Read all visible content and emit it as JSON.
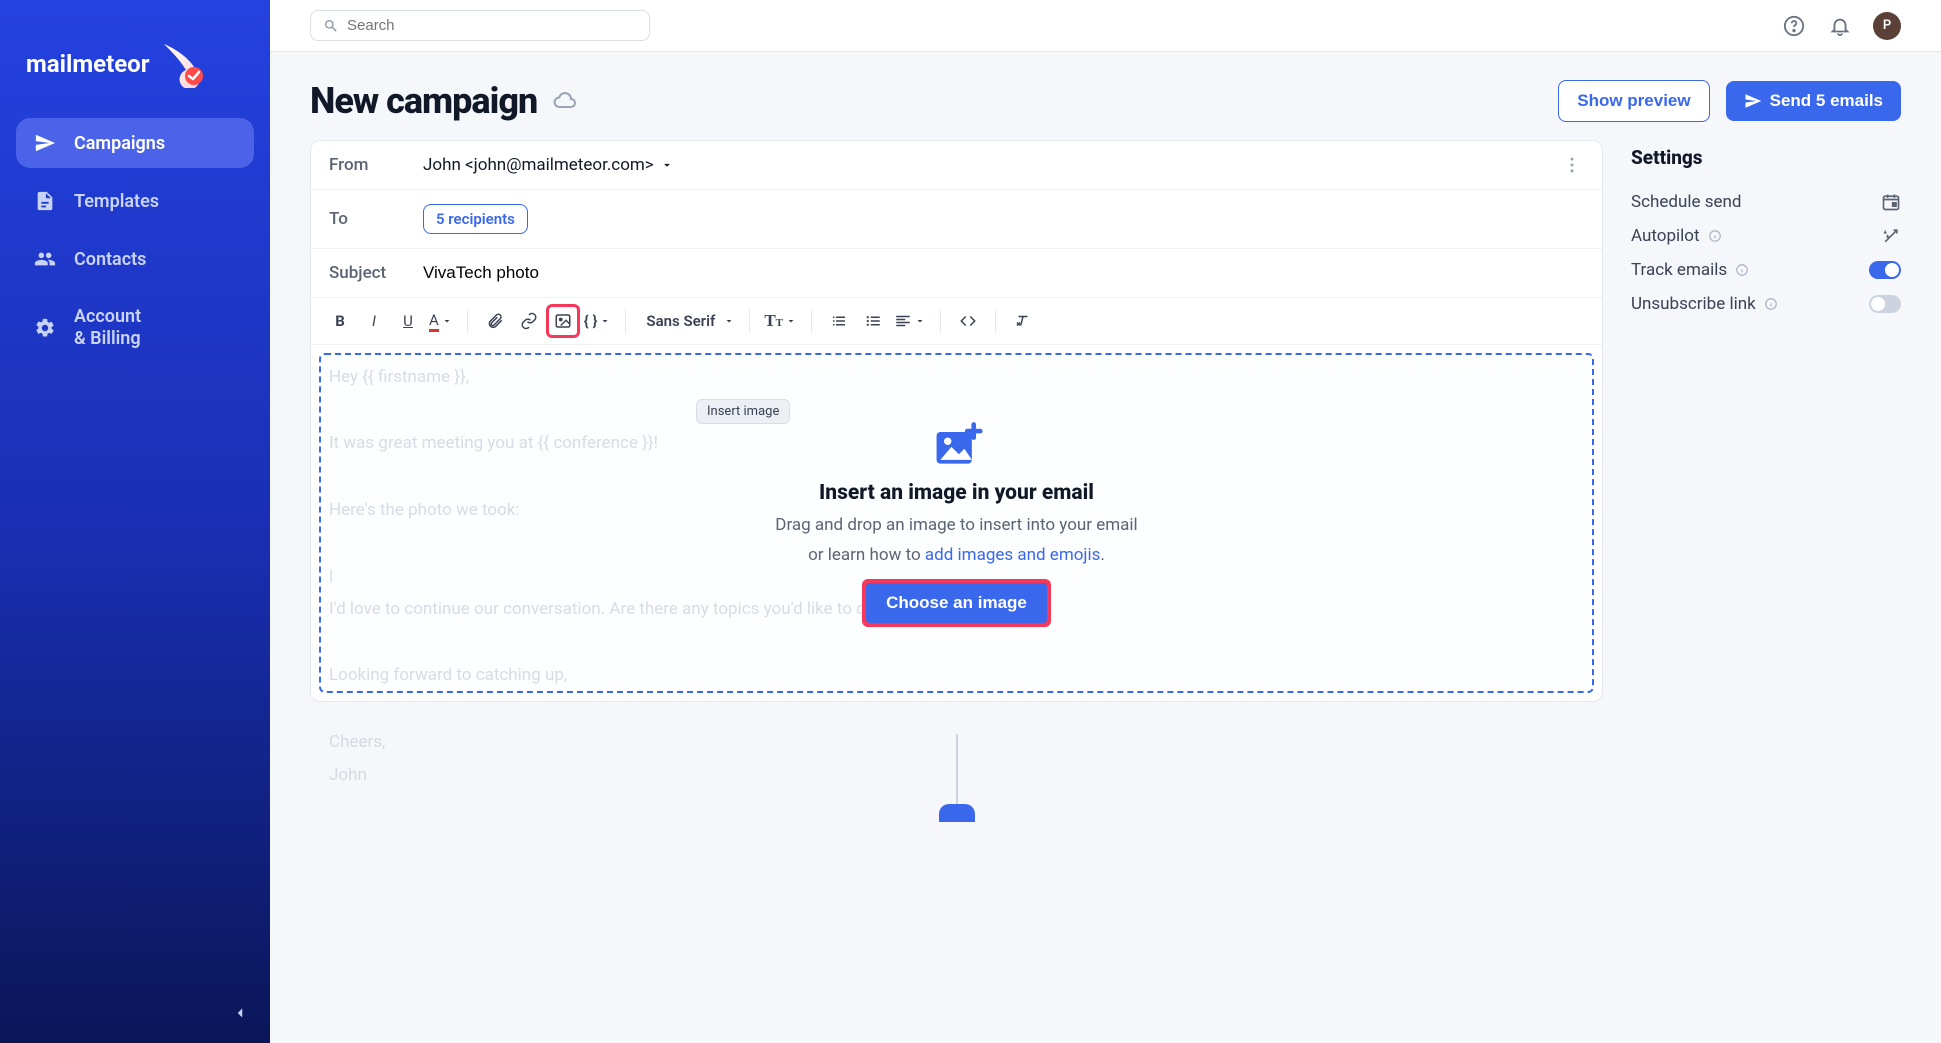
{
  "brand": {
    "name": "mailmeteor"
  },
  "sidebar": {
    "items": [
      {
        "icon": "send-icon",
        "label": "Campaigns",
        "active": true
      },
      {
        "icon": "file-icon",
        "label": "Templates"
      },
      {
        "icon": "people-icon",
        "label": "Contacts"
      },
      {
        "icon": "gear-icon",
        "label_line1": "Account",
        "label_line2": "& Billing"
      }
    ]
  },
  "topbar": {
    "search_placeholder": "Search",
    "avatar_initial": "P"
  },
  "header": {
    "title": "New campaign",
    "preview_label": "Show preview",
    "send_label": "Send 5 emails"
  },
  "compose": {
    "from_label": "From",
    "from_value": "John <john@mailmeteor.com>",
    "to_label": "To",
    "recipients_chip": "5 recipients",
    "subject_label": "Subject",
    "subject_value": "VivaTech photo",
    "font_label": "Sans Serif",
    "tooltip": "Insert image",
    "ghost_body": "Hey {{ firstname }},\n\nIt was great meeting you at {{ conference }}!\n\nHere's the photo we took:\n\n|\nI'd love to continue our conversation. Are there any topics you'd like to discuss further?\n\nLooking forward to catching up,\n\nCheers,\nJohn"
  },
  "dropzone": {
    "title": "Insert an image in your email",
    "line1": "Drag and drop an image to insert into your email",
    "line2_prefix": "or learn how to ",
    "line2_link": "add images and emojis",
    "line2_suffix": ".",
    "button": "Choose an image"
  },
  "settings": {
    "title": "Settings",
    "rows": [
      {
        "label": "Schedule send",
        "control": "calendar"
      },
      {
        "label": "Autopilot",
        "info": true,
        "control": "wand"
      },
      {
        "label": "Track emails",
        "info": true,
        "control": "toggle-on"
      },
      {
        "label": "Unsubscribe link",
        "info": true,
        "control": "toggle-off"
      }
    ]
  }
}
